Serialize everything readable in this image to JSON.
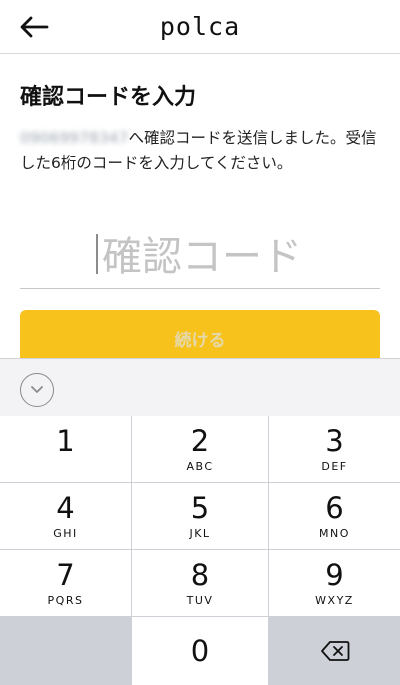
{
  "header": {
    "back_icon": "arrow-left-icon",
    "brand": "polca"
  },
  "page": {
    "title": "確認コードを入力",
    "phone_blurred": "09069978347",
    "description_rest": "へ確認コードを送信しました。受信した6桁のコードを入力してください。"
  },
  "code_field": {
    "placeholder": "確認コード",
    "value": ""
  },
  "continue_button": {
    "label": "続ける",
    "color": "#f7c21c"
  },
  "keyboard": {
    "dismiss_icon": "chevron-down-circle-icon",
    "keys": [
      {
        "num": "1",
        "letters": ""
      },
      {
        "num": "2",
        "letters": "ABC"
      },
      {
        "num": "3",
        "letters": "DEF"
      },
      {
        "num": "4",
        "letters": "GHI"
      },
      {
        "num": "5",
        "letters": "JKL"
      },
      {
        "num": "6",
        "letters": "MNO"
      },
      {
        "num": "7",
        "letters": "PQRS"
      },
      {
        "num": "8",
        "letters": "TUV"
      },
      {
        "num": "9",
        "letters": "WXYZ"
      },
      {
        "num": "0",
        "letters": ""
      }
    ],
    "backspace_icon": "backspace-icon"
  }
}
